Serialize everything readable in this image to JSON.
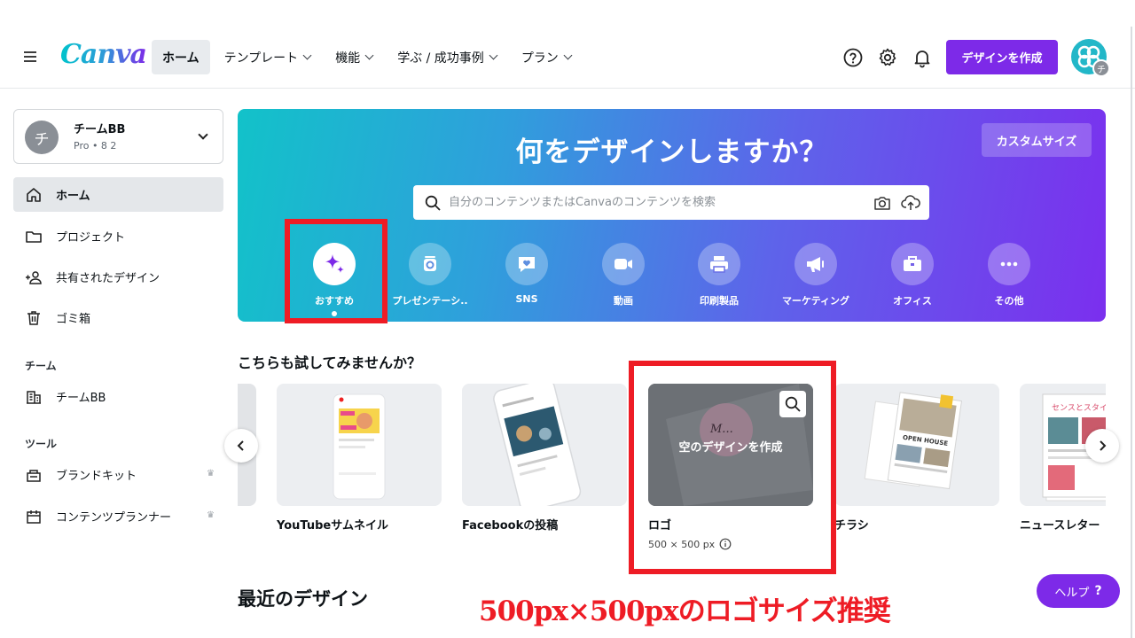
{
  "topbar": {
    "logo": "Canva",
    "nav": [
      {
        "label": "ホーム",
        "active": true,
        "dropdown": false
      },
      {
        "label": "テンプレート",
        "dropdown": true
      },
      {
        "label": "機能",
        "dropdown": true
      },
      {
        "label": "学ぶ / 成功事例",
        "dropdown": true
      },
      {
        "label": "プラン",
        "dropdown": true
      }
    ],
    "icons": [
      "help-icon",
      "gear-icon",
      "bell-icon"
    ],
    "create_button": "デザインを作成",
    "avatar_initial": "チ"
  },
  "sidebar": {
    "team": {
      "initial": "チ",
      "name": "チームBB",
      "sub": "Pro • 8 2"
    },
    "items": [
      {
        "label": "ホーム",
        "icon": "home-icon",
        "active": true
      },
      {
        "label": "プロジェクト",
        "icon": "folder-icon"
      },
      {
        "label": "共有されたデザイン",
        "icon": "shared-users-icon"
      },
      {
        "label": "ゴミ箱",
        "icon": "trash-icon"
      }
    ],
    "team_heading": "チーム",
    "team_items": [
      {
        "label": "チームBB",
        "icon": "building-icon"
      }
    ],
    "tools_heading": "ツール",
    "tools": [
      {
        "label": "ブランドキット",
        "icon": "brand-kit-icon",
        "crown": "♛"
      },
      {
        "label": "コンテンツプランナー",
        "icon": "calendar-icon",
        "crown": "♛"
      }
    ]
  },
  "hero": {
    "title": "何をデザインしますか？",
    "custom_size": "カスタムサイズ",
    "search_placeholder": "自分のコンテンツまたはCanvaのコンテンツを検索",
    "categories": [
      {
        "label": "おすすめ",
        "icon": "sparkle-icon",
        "active": true
      },
      {
        "label": "プレゼンテーシ..",
        "icon": "presentation-icon"
      },
      {
        "label": "SNS",
        "icon": "heart-chat-icon"
      },
      {
        "label": "動画",
        "icon": "video-camera-icon"
      },
      {
        "label": "印刷製品",
        "icon": "printer-icon"
      },
      {
        "label": "マーケティング",
        "icon": "megaphone-icon"
      },
      {
        "label": "オフィス",
        "icon": "briefcase-icon"
      },
      {
        "label": "その他",
        "icon": "more-dots-icon"
      }
    ]
  },
  "suggestions": {
    "title": "こちらも試してみませんか？",
    "cards": [
      {
        "label": "YouTubeサムネイル"
      },
      {
        "label": "Facebookの投稿"
      },
      {
        "label": "ロゴ",
        "size": "500 × 500 px",
        "hover_text": "空のデザインを作成",
        "thumb_text": "M..."
      },
      {
        "label": "チラシ",
        "thumb_text": "OPEN HOUSE"
      },
      {
        "label": "ニュースレター",
        "thumb_text": "センスとスタイ"
      }
    ]
  },
  "recent": {
    "title": "最近のデザイン"
  },
  "help_button": {
    "label": "ヘルプ",
    "icon": "?"
  },
  "caption": "500px×500pxのロゴサイズ推奨",
  "colors": {
    "accent": "#7d2ae8",
    "annotation": "#ee1c25",
    "hero_start": "#12c2c9",
    "hero_end": "#7b2fee"
  }
}
